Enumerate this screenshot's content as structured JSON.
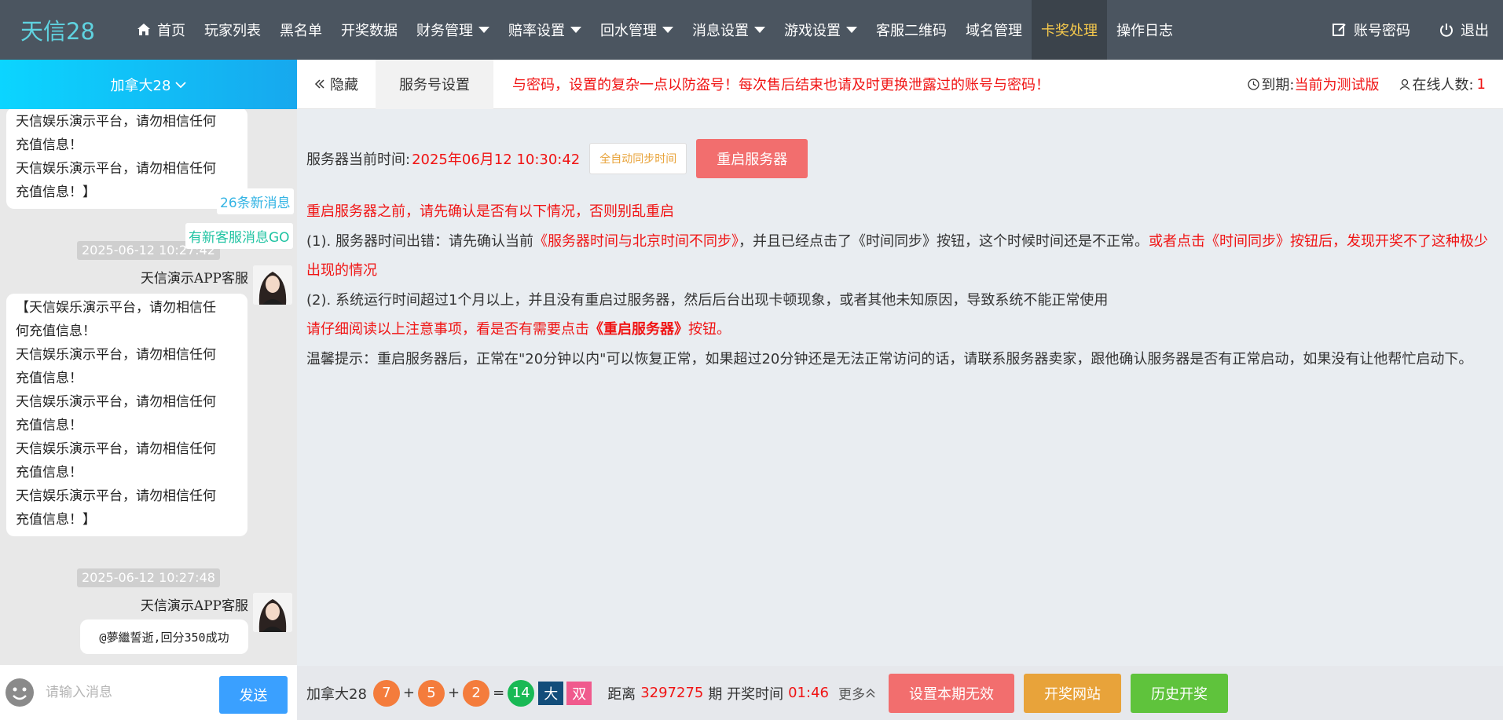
{
  "app": {
    "logo": "天信28"
  },
  "nav": {
    "items": [
      {
        "label": "首页"
      },
      {
        "label": "玩家列表"
      },
      {
        "label": "黑名单"
      },
      {
        "label": "开奖数据"
      },
      {
        "label": "财务管理"
      },
      {
        "label": "赔率设置"
      },
      {
        "label": "回水管理"
      },
      {
        "label": "消息设置"
      },
      {
        "label": "游戏设置"
      },
      {
        "label": "客服二维码"
      },
      {
        "label": "域名管理"
      },
      {
        "label": "卡奖处理"
      },
      {
        "label": "操作日志"
      }
    ],
    "active": "卡奖处理",
    "account": "账号密码",
    "logout": "退出"
  },
  "left": {
    "region": "加拿大28",
    "new_messages": "26条新消息",
    "new_service": "有新客服消息GO",
    "msg1": {
      "lines": [
        "天信娱乐演示平台，请勿相信任何",
        "充值信息！",
        "天信娱乐演示平台，请勿相信任何",
        "充值信息！】"
      ]
    },
    "msg2": {
      "time": "2025-06-12 10:27:42",
      "sender": "天信演示APP客服",
      "lines": [
        "【天信娱乐演示平台，请勿相信任",
        "何充值信息！",
        "天信娱乐演示平台，请勿相信任何",
        "充值信息！",
        "天信娱乐演示平台，请勿相信任何",
        "充值信息！",
        "天信娱乐演示平台，请勿相信任何",
        "充值信息！",
        "天信娱乐演示平台，请勿相信任何",
        "充值信息！】"
      ]
    },
    "msg3": {
      "time": "2025-06-12 10:27:48",
      "sender": "天信演示APP客服",
      "text": "@夢繼誓逝,回分350成功"
    },
    "input_placeholder": "请输入消息",
    "send": "发送"
  },
  "subbar": {
    "hide": "隐藏",
    "tab": "服务号设置",
    "marquee": "与密码，设置的复杂一点以防盗号！每次售后结束也请及时更换泄露过的账号与密码！",
    "expire_label": "到期:",
    "expire_value": "当前为测试版",
    "online_label": "在线人数:",
    "online_value": "1"
  },
  "main": {
    "server_time_label": "服务器当前时间:",
    "server_time": "2025年06月12 10:30:42",
    "sync_btn": "全自动同步时间",
    "restart_btn": "重启服务器",
    "note_title": "重启服务器之前，请先确认是否有以下情况，否则别乱重启",
    "note1_a": "(1). 服务器时间出错：请先确认当前",
    "note1_b": "《服务器时间与北京时间不同步》",
    "note1_c": "，并且已经点击了《时间同步》按钮，这个时候时间还是不正常。",
    "note1_d": "或者点击《时间同步》按钮后，发现开奖不了这种极少出现的情况",
    "note2": "(2). 系统运行时间超过1个月以上，并且没有重启过服务器，然后后台出现卡顿现象，或者其他未知原因，导致系统不能正常使用",
    "note3_a": "请仔细阅读以上注意事项，看是否有需要点击",
    "note3_b": "《重启服务器》",
    "note3_c": "按钮。",
    "note4": "温馨提示：重启服务器后，正常在\"20分钟以内\"可以恢复正常，如果超过20分钟还是无法正常访问的话，请联系服务器卖家，跟他确认服务器是否有正常启动，如果没有让他帮忙启动下。"
  },
  "bottom": {
    "region": "加拿大28",
    "n1": "7",
    "n2": "5",
    "n3": "2",
    "sum": "14",
    "plus": "+",
    "eq": "=",
    "tag_big": "大",
    "tag_pair": "双",
    "distance_label": "距离",
    "period": "3297275",
    "period_label": "期 开奖时间",
    "countdown": "01:46",
    "more": "更多",
    "btn_invalid": "设置本期无效",
    "btn_site": "开奖网站",
    "btn_history": "历史开奖"
  },
  "colors": {
    "nav_bg": "#4b5560",
    "active_nav": "#f6c94c",
    "accent_red": "#f01414",
    "send_blue": "#3aa0ff"
  }
}
